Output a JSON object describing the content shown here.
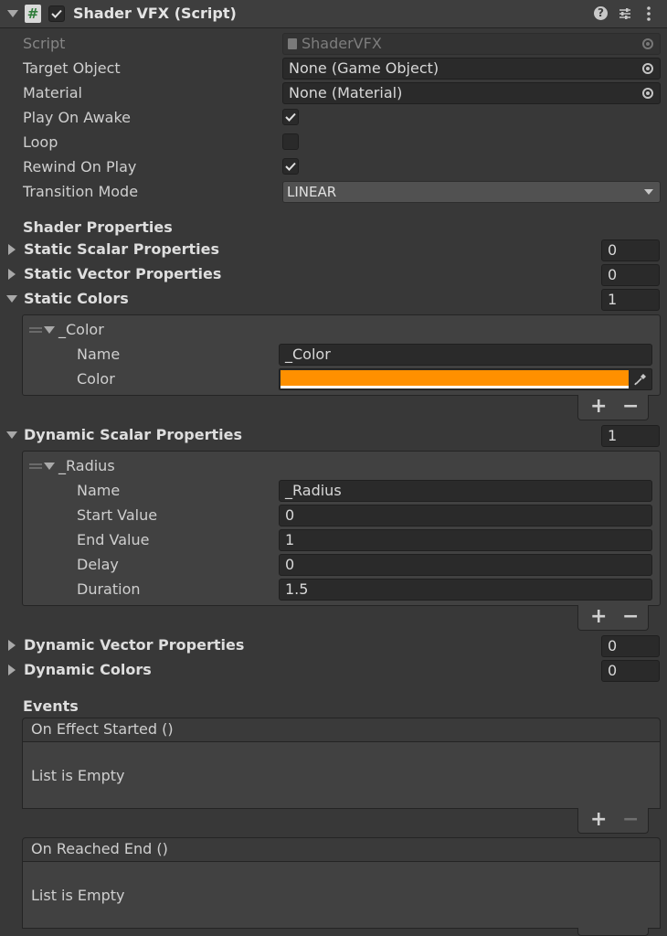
{
  "header": {
    "title": "Shader VFX (Script)",
    "enabled": true,
    "help_icon": "help-icon",
    "settings_icon": "sliders-icon",
    "menu_icon": "kebab-menu-icon"
  },
  "fields": {
    "script": {
      "label": "Script",
      "value": "ShaderVFX"
    },
    "target_object": {
      "label": "Target Object",
      "value": "None (Game Object)"
    },
    "material": {
      "label": "Material",
      "value": "None (Material)"
    },
    "play_on_awake": {
      "label": "Play On Awake",
      "checked": true
    },
    "loop": {
      "label": "Loop",
      "checked": false
    },
    "rewind_on_play": {
      "label": "Rewind On Play",
      "checked": true
    },
    "transition_mode": {
      "label": "Transition Mode",
      "value": "LINEAR"
    }
  },
  "shader_properties": {
    "heading": "Shader Properties",
    "static_scalar": {
      "label": "Static Scalar Properties",
      "count": "0"
    },
    "static_vector": {
      "label": "Static Vector Properties",
      "count": "0"
    },
    "static_colors": {
      "label": "Static Colors",
      "count": "1",
      "item": {
        "title": "_Color",
        "name_label": "Name",
        "name_value": "_Color",
        "color_label": "Color",
        "color_value": "#ff9000"
      }
    },
    "dynamic_scalar": {
      "label": "Dynamic Scalar Properties",
      "count": "1",
      "item": {
        "title": "_Radius",
        "name_label": "Name",
        "name_value": "_Radius",
        "start_label": "Start Value",
        "start_value": "0",
        "end_label": "End Value",
        "end_value": "1",
        "delay_label": "Delay",
        "delay_value": "0",
        "duration_label": "Duration",
        "duration_value": "1.5"
      }
    },
    "dynamic_vector": {
      "label": "Dynamic Vector Properties",
      "count": "0"
    },
    "dynamic_colors": {
      "label": "Dynamic Colors",
      "count": "0"
    }
  },
  "events": {
    "heading": "Events",
    "on_effect_started": {
      "title": "On Effect Started ()",
      "empty": "List is Empty"
    },
    "on_reached_end": {
      "title": "On Reached End ()",
      "empty": "List is Empty"
    }
  },
  "list_controls": {
    "add": "+",
    "remove": "−"
  }
}
